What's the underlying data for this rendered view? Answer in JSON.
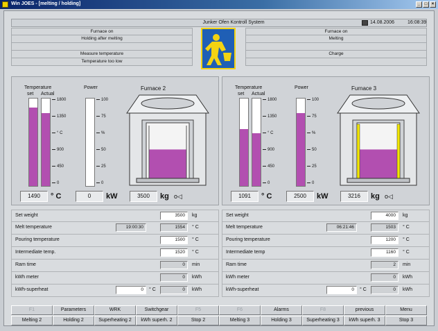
{
  "window": {
    "title": "Win JOES - [melting / holding]"
  },
  "header": {
    "system_name": "Junker Ofen Kontroll System",
    "date": "14.08.2006",
    "time": "16:08:39"
  },
  "status_left": [
    "Furnace on",
    "Holding after melting",
    "",
    "Measure temperature",
    "Temperature too low"
  ],
  "status_right": [
    "Furnace on",
    "Melting",
    "",
    "Charge",
    ""
  ],
  "furnaces": [
    {
      "name": "Furnace 2",
      "temp_label": "Temperature",
      "set_label": "set",
      "actual_label": "Actual",
      "power_label": "Power",
      "temp_set_level": 0.9,
      "temp_actual_level": 0.83,
      "power_level": 0.0,
      "crucible_level": 0.52,
      "temp_ticks": [
        "1800",
        "1350",
        "° C",
        "900",
        "450",
        "0"
      ],
      "power_ticks": [
        "100",
        "75",
        "%",
        "50",
        "25",
        "0"
      ],
      "temperature": "1490",
      "temp_unit": "° C",
      "power": "0",
      "power_unit": "kW",
      "weight": "3500",
      "weight_unit": "kg",
      "tilt_symbol": "o◁"
    },
    {
      "name": "Furnace 3",
      "temp_label": "Temperature",
      "set_label": "set",
      "actual_label": "Actual",
      "power_label": "Power",
      "temp_set_level": 0.65,
      "temp_actual_level": 0.6,
      "power_level": 0.83,
      "crucible_level": 0.52,
      "temp_ticks": [
        "1800",
        "1350",
        "° C",
        "900",
        "450",
        "0"
      ],
      "power_ticks": [
        "100",
        "75",
        "%",
        "50",
        "25",
        "0"
      ],
      "temperature": "1091",
      "temp_unit": "° C",
      "power": "2500",
      "power_unit": "kW",
      "weight": "3216",
      "weight_unit": "kg",
      "tilt_symbol": "o◁"
    }
  ],
  "params_left": [
    {
      "label": "Set weight",
      "time": "",
      "value": "3500",
      "unit": "kg",
      "editable": true
    },
    {
      "label": "Melt temperature",
      "time": "19:00:30",
      "value": "1554",
      "unit": "° C",
      "editable": false
    },
    {
      "label": "Pouring temperature",
      "time": "",
      "value": "1500",
      "unit": "° C",
      "editable": true
    },
    {
      "label": "Intermediate temp.",
      "time": "",
      "value": "1520",
      "unit": "° C",
      "editable": true
    },
    {
      "label": "Ram time",
      "time": "",
      "value": "0",
      "unit": "min",
      "editable": false
    },
    {
      "label": "kWh meter",
      "time": "",
      "value": "0",
      "unit": "kWh",
      "editable": false
    },
    {
      "label": "kWh-superheat",
      "time": "",
      "value": "0",
      "unit": "kWh",
      "editable": false,
      "extra_value": "0",
      "extra_unit": "° C"
    }
  ],
  "params_right": [
    {
      "label": "Set weight",
      "time": "",
      "value": "4000",
      "unit": "kg",
      "editable": true
    },
    {
      "label": "Melt temperature",
      "time": "06:21:46",
      "value": "1503",
      "unit": "° C",
      "editable": false
    },
    {
      "label": "Pouring temperature",
      "time": "",
      "value": "1200",
      "unit": "° C",
      "editable": true
    },
    {
      "label": "Intermediate temp",
      "time": "",
      "value": "1160",
      "unit": "° C",
      "editable": true
    },
    {
      "label": "Ram time",
      "time": "",
      "value": "2",
      "unit": "min",
      "editable": false
    },
    {
      "label": "kWh meter",
      "time": "",
      "value": "0",
      "unit": "kWh",
      "editable": false
    },
    {
      "label": "kWh-superheat",
      "time": "",
      "value": "0",
      "unit": "kWh",
      "editable": false,
      "extra_value": "0",
      "extra_unit": "° C"
    }
  ],
  "fkeys_top": [
    {
      "label": "F1",
      "enabled": false
    },
    {
      "label": "Parameters",
      "enabled": true
    },
    {
      "label": "WRK",
      "enabled": true
    },
    {
      "label": "Switchgear",
      "enabled": true
    },
    {
      "label": "F5",
      "enabled": false
    },
    {
      "label": "F6",
      "enabled": false
    },
    {
      "label": "Alarms",
      "enabled": true
    },
    {
      "label": "F8",
      "enabled": false
    },
    {
      "label": "previous",
      "enabled": true
    },
    {
      "label": "Menu",
      "enabled": true
    }
  ],
  "fkeys_bottom": [
    {
      "label": "Melting 2",
      "enabled": true
    },
    {
      "label": "Holding 2",
      "enabled": true
    },
    {
      "label": "Superheating 2",
      "enabled": true
    },
    {
      "label": "kWh superh. 2",
      "enabled": true
    },
    {
      "label": "Stop 2",
      "enabled": true
    },
    {
      "label": "Melting 3",
      "enabled": true
    },
    {
      "label": "Holding 3",
      "enabled": true
    },
    {
      "label": "Superheating 3",
      "enabled": true
    },
    {
      "label": "kWh superh. 3",
      "enabled": true
    },
    {
      "label": "Stop 3",
      "enabled": true
    }
  ],
  "colors": {
    "melt_fill": "#b24fb0",
    "coil_highlight": "#f2e600",
    "title_bar": "#0a246a"
  },
  "icons": [
    "app-icon",
    "minimize-icon",
    "maximize-icon",
    "close-icon",
    "calendar-icon",
    "junker-logo-icon",
    "tilt-indicator-icon"
  ]
}
